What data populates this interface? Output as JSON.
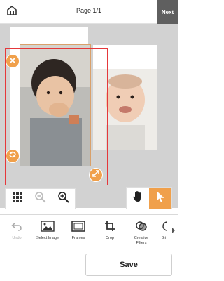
{
  "header": {
    "title": "Page 1/1",
    "next_label": "Next"
  },
  "canvas": {
    "selection_color": "#e5383b",
    "handle_color": "#f0a04b"
  },
  "view_controls": {
    "icons": [
      "grid-icon",
      "zoom-out-icon",
      "zoom-in-icon"
    ]
  },
  "mode_controls": {
    "icons": [
      "hand-icon",
      "pointer-icon"
    ],
    "active": "pointer"
  },
  "toolbar": {
    "items": [
      {
        "label": "Undo",
        "icon": "undo-icon",
        "enabled": false
      },
      {
        "label": "Select Image",
        "icon": "select-image-icon",
        "enabled": true
      },
      {
        "label": "Frames",
        "icon": "frames-icon",
        "enabled": true
      },
      {
        "label": "Crop",
        "icon": "crop-icon",
        "enabled": true
      },
      {
        "label": "Creative\nFilters",
        "icon": "creative-filters-icon",
        "enabled": true
      },
      {
        "label": "Bri",
        "icon": "brightness-icon",
        "enabled": true
      }
    ]
  },
  "footer": {
    "save_label": "Save"
  }
}
